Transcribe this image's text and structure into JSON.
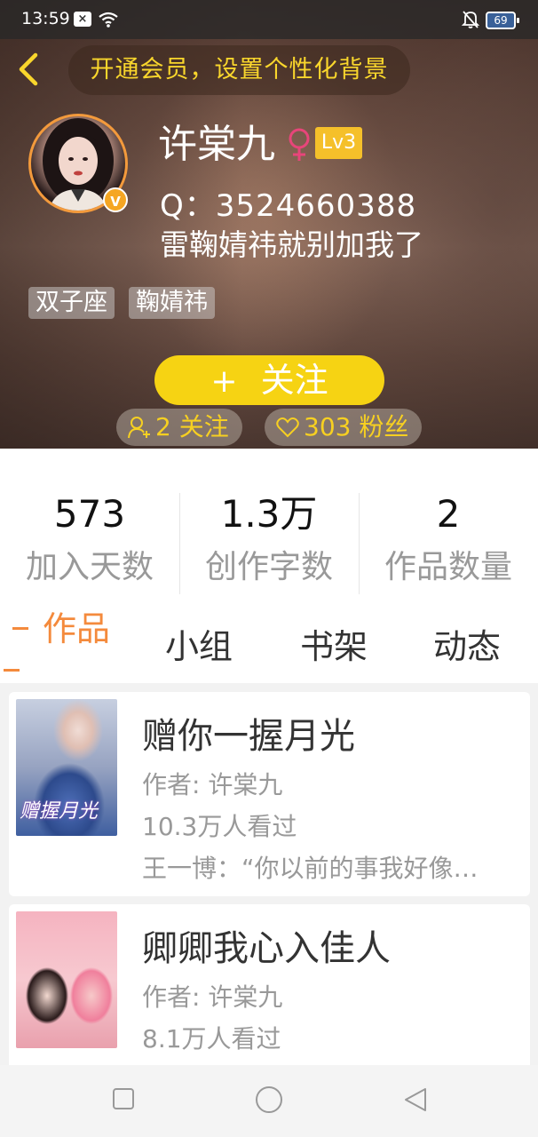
{
  "status_bar": {
    "time": "13:59",
    "battery": "69",
    "icons": [
      "close-box-icon",
      "wifi-icon",
      "bell-off-icon",
      "battery-icon"
    ]
  },
  "header": {
    "vip_banner": "开通会员，设置个性化背景",
    "back_icon": "chevron-left-icon",
    "accent_color": "#f9d62c"
  },
  "profile": {
    "username": "许棠九",
    "gender_symbol": "♀",
    "gender_color": "#e8457a",
    "level": "Lv3",
    "verified_badge": "V",
    "qq": "Q：3524660388",
    "bio": "雷鞠婧祎就别加我了",
    "tags": [
      "双子座",
      "鞠婧祎"
    ],
    "follow_button": "关注",
    "follow_plus": "+",
    "following": "2 关注",
    "fans": "303 粉丝"
  },
  "stats": [
    {
      "value": "573",
      "label": "加入天数"
    },
    {
      "value": "1.3万",
      "label": "创作字数"
    },
    {
      "value": "2",
      "label": "作品数量"
    }
  ],
  "tabs": [
    {
      "label": "作品",
      "active": true
    },
    {
      "label": "小组",
      "active": false
    },
    {
      "label": "书架",
      "active": false
    },
    {
      "label": "动态",
      "active": false
    }
  ],
  "works": [
    {
      "title": "赠你一握月光",
      "author": "作者: 许棠九",
      "views": "10.3万人看过",
      "snippet": "王一博：“你以前的事我好像…",
      "cover_text": "赠握月光"
    },
    {
      "title": "卿卿我心入佳人",
      "author": "作者: 许棠九",
      "views": "8.1万人看过",
      "snippet": "",
      "cover_text": ""
    }
  ],
  "nav": [
    "square-icon",
    "circle-icon",
    "triangle-back-icon"
  ]
}
